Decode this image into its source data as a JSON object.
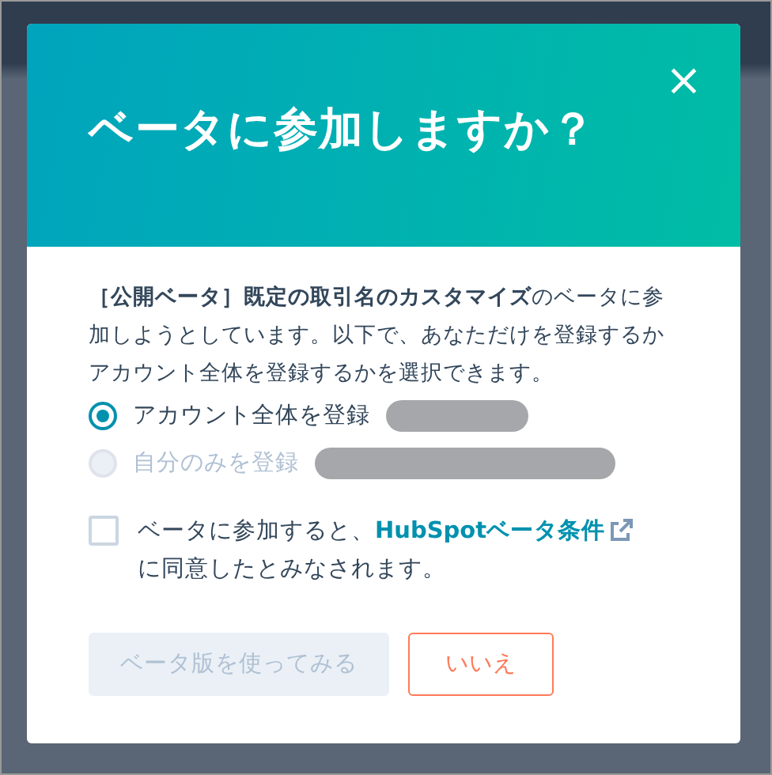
{
  "dialog": {
    "title": "ベータに参加しますか？",
    "close": "×",
    "intro": "**［公開ベータ］既定の取引名のカスタマイズ**のベータに参加しようとしています。以下で、あなただけを登録するかアカウント全体を登録するかを選択できます。",
    "options": [
      {
        "label": "アカウント全体を登録",
        "selected": true,
        "disabled": false,
        "redacted": true
      },
      {
        "label": "自分のみを登録",
        "selected": false,
        "disabled": true,
        "redacted": true
      }
    ],
    "agreement": {
      "checked": false,
      "before": "ベータに参加すると、",
      "link": "HubSpotベータ条件",
      "after": "に同意したとみなされます。"
    },
    "buttons": [
      {
        "label": "ベータ版を使ってみる",
        "kind": "primary",
        "disabled": true
      },
      {
        "label": "いいえ",
        "kind": "secondary",
        "disabled": false
      }
    ]
  }
}
